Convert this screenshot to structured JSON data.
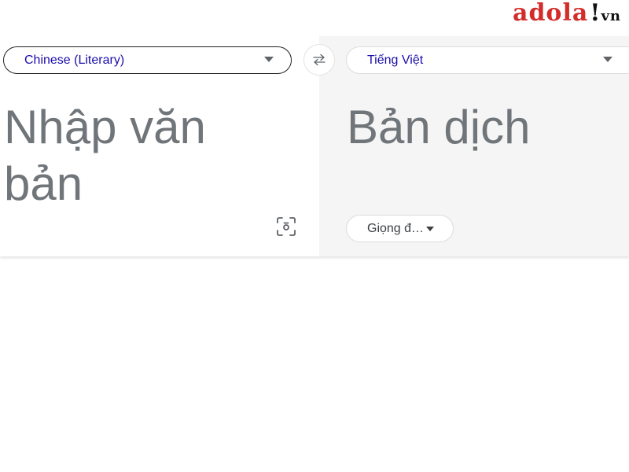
{
  "watermark": {
    "name": "adola",
    "bang": "!",
    "tld": "vn"
  },
  "source": {
    "language": "Chinese (Literary)",
    "placeholder": "Nhập văn bản"
  },
  "target": {
    "language": "Tiếng Việt",
    "placeholder": "Bản dịch",
    "voice_label": "Giọng đ…"
  },
  "icons": {
    "swap": "swap-arrows-icon",
    "camera": "camera-scan-icon",
    "dropdown": "chevron-down-icon"
  },
  "colors": {
    "language_text": "#1a0dab",
    "placeholder_text": "#70757a",
    "logo_red": "#d42b2b",
    "right_pane_bg": "#f5f5f5"
  }
}
